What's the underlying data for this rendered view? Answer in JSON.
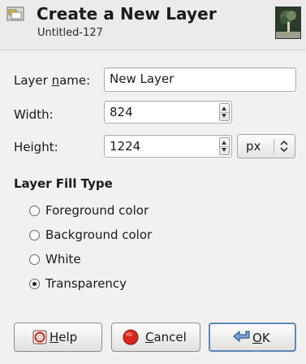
{
  "header": {
    "title": "Create a New Layer",
    "subtitle": "Untitled-127"
  },
  "form": {
    "layer_name_label_pre": "Layer ",
    "layer_name_label_mn": "n",
    "layer_name_label_post": "ame:",
    "layer_name_value": "New Layer",
    "width_label": "Width:",
    "width_value": "824",
    "height_label": "Height:",
    "height_value": "1224",
    "unit": "px"
  },
  "fill": {
    "title": "Layer Fill Type",
    "options": [
      {
        "label": "Foreground color",
        "checked": false
      },
      {
        "label": "Background color",
        "checked": false
      },
      {
        "label": "White",
        "checked": false
      },
      {
        "label": "Transparency",
        "checked": true
      }
    ]
  },
  "buttons": {
    "help_mn": "H",
    "help_rest": "elp",
    "cancel_mn": "C",
    "cancel_rest": "ancel",
    "ok_mn": "O",
    "ok_rest": "K"
  },
  "colors": {
    "background": "#f2f1f0",
    "default_border": "#5d87b8",
    "cancel_red": "#d9261c"
  }
}
